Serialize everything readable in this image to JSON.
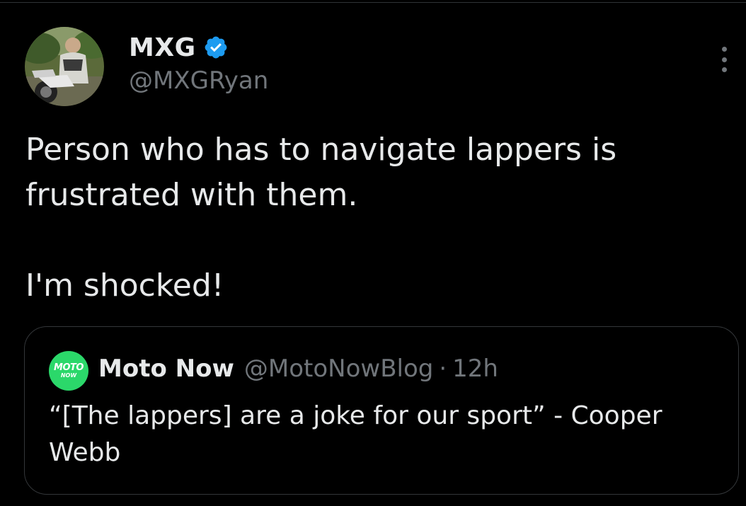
{
  "tweet": {
    "author": {
      "display_name": "MXG",
      "handle": "@MXGRyan",
      "verified": true,
      "verified_icon": "verified-badge-icon",
      "verified_color": "#1d9bf0"
    },
    "more_icon": "more-options-icon",
    "text_lines": [
      "Person who has to navigate lappers is frustrated with them.",
      "I'm shocked!"
    ]
  },
  "quoted_tweet": {
    "avatar_text_line1": "MOTO",
    "avatar_text_line2": "NOW",
    "avatar_color": "#2bd86a",
    "display_name": "Moto Now",
    "handle": "@MotoNowBlog",
    "separator": "·",
    "time": "12h",
    "text": "“[The lappers] are a joke for our sport” - Cooper Webb"
  },
  "colors": {
    "background": "#000000",
    "primary_text": "#e7e9ea",
    "secondary_text": "#71767b",
    "border": "#333639"
  }
}
